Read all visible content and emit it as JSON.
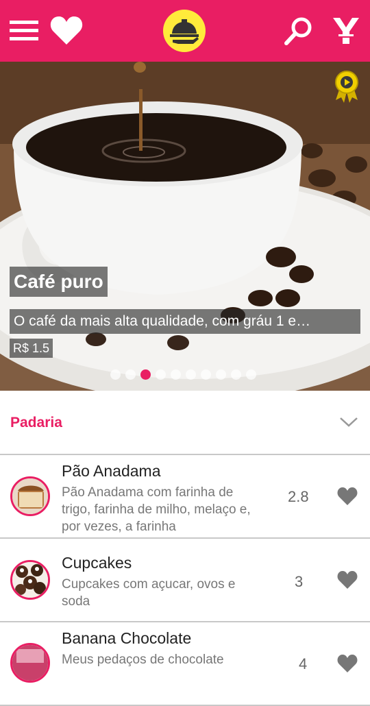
{
  "topbar": {
    "background": "#e91e63",
    "icons": [
      "menu-icon",
      "heart-icon",
      "restaurant-logo",
      "search-icon",
      "filter-icon"
    ]
  },
  "hero": {
    "title": "Café puro",
    "description": "O café da mais alta qualidade, com gráu 1 e…",
    "price": "R$ 1.5",
    "page_count": 10,
    "active_page": 3
  },
  "category": {
    "label": "Padaria"
  },
  "products": [
    {
      "name": "Pão Anadama",
      "description": "Pão Anadama com farinha de trigo, farinha de milho, melaço e, por vezes, a farinha",
      "rating": "2.8"
    },
    {
      "name": "Cupcakes",
      "description": "Cupcakes com açucar, ovos e soda",
      "rating": "3"
    },
    {
      "name": "Banana Chocolate",
      "description": "Meus pedaços de chocolate",
      "rating": "4"
    }
  ],
  "colors": {
    "accent": "#e91e63",
    "logo_yellow": "#ffeb3b",
    "muted": "#666666"
  }
}
